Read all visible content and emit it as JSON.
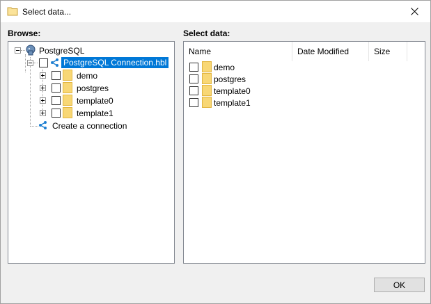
{
  "window": {
    "title": "Select data..."
  },
  "browse": {
    "label": "Browse:",
    "tree": {
      "root": "PostgreSQL",
      "connection": "PostgreSQL Connection.hbl",
      "databases": [
        "demo",
        "postgres",
        "template0",
        "template1"
      ],
      "create": "Create a connection"
    }
  },
  "select_data": {
    "label": "Select data:",
    "columns": [
      "Name",
      "Date Modified",
      "Size"
    ],
    "rows": [
      "demo",
      "postgres",
      "template0",
      "template1"
    ]
  },
  "buttons": {
    "ok": "OK"
  },
  "colors": {
    "selection": "#0078d7",
    "folder": "#f8d775",
    "connection_icon": "#1e7fd1"
  }
}
